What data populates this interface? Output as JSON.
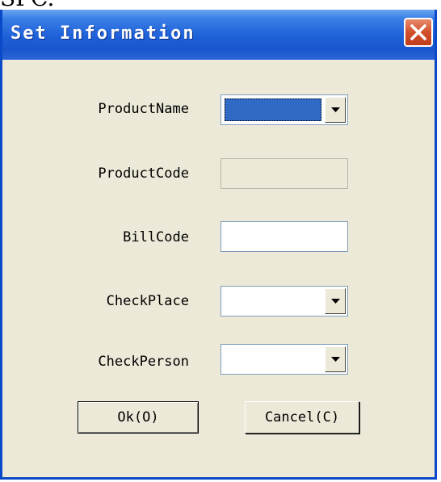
{
  "stray_caption": "SPC.",
  "window": {
    "title": "Set Information",
    "close_glyph": "✕"
  },
  "form": {
    "product_name": {
      "label": "ProductName",
      "value": "",
      "selected": true
    },
    "product_code": {
      "label": "ProductCode",
      "value": "",
      "enabled": false
    },
    "bill_code": {
      "label": "BillCode",
      "value": ""
    },
    "check_place": {
      "label": "CheckPlace",
      "value": ""
    },
    "check_person": {
      "label": "CheckPerson",
      "value": ""
    }
  },
  "buttons": {
    "ok": "Ok(O)",
    "cancel": "Cancel(C)"
  },
  "icons": {
    "close": "close-icon",
    "dropdown": "chevron-down-icon"
  },
  "colors": {
    "titlebar": "#1d5fd8",
    "dialog_bg": "#ece9d8",
    "selection": "#316ac5",
    "close_button": "#d2502c"
  }
}
